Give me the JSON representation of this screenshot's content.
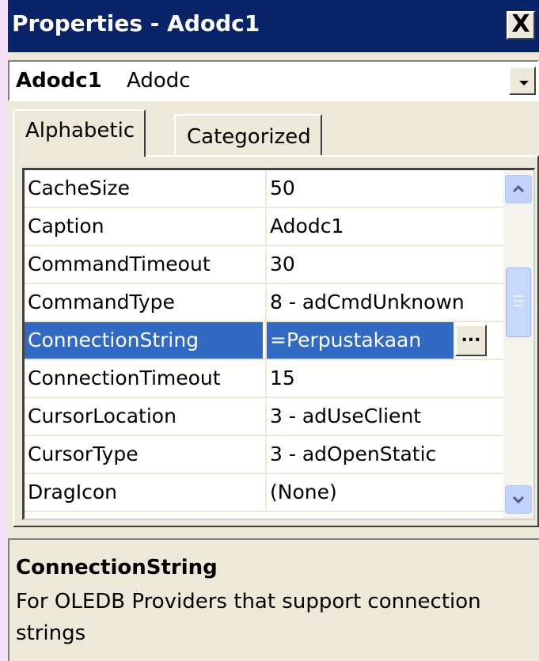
{
  "window": {
    "title": "Properties - Adodc1",
    "close_label": "X"
  },
  "object_combo": {
    "name": "Adodc1",
    "type": "Adodc"
  },
  "tabs": [
    {
      "label": "Alphabetic",
      "active": true
    },
    {
      "label": "Categorized",
      "active": false
    }
  ],
  "properties": [
    {
      "name": "CacheSize",
      "value": "50"
    },
    {
      "name": "Caption",
      "value": "Adodc1"
    },
    {
      "name": "CommandTimeout",
      "value": "30"
    },
    {
      "name": "CommandType",
      "value": "8 - adCmdUnknown"
    },
    {
      "name": "ConnectionString",
      "value": "=Perpustakaan",
      "selected": true
    },
    {
      "name": "ConnectionTimeout",
      "value": "15"
    },
    {
      "name": "CursorLocation",
      "value": "3 - adUseClient"
    },
    {
      "name": "CursorType",
      "value": "3 - adOpenStatic"
    },
    {
      "name": "DragIcon",
      "value": "(None)"
    }
  ],
  "ellipsis_label": "...",
  "description": {
    "title": "ConnectionString",
    "text": "For OLEDB Providers that support connection strings"
  },
  "colors": {
    "titlebar": "#0a246a",
    "selection": "#316ac5",
    "window_face": "#ece9d8"
  }
}
